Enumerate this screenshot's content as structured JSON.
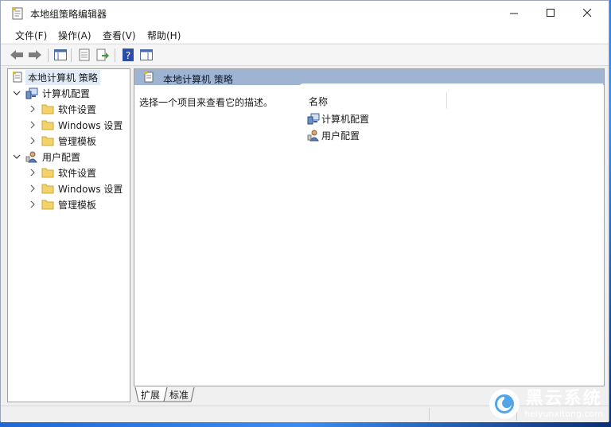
{
  "window": {
    "title": "本地组策略编辑器"
  },
  "menu": [
    {
      "label": "文件(F)"
    },
    {
      "label": "操作(A)"
    },
    {
      "label": "查看(V)"
    },
    {
      "label": "帮助(H)"
    }
  ],
  "tree": {
    "root": "本地计算机 策略",
    "computer": {
      "label": "计算机配置",
      "children": [
        {
          "label": "软件设置"
        },
        {
          "label": "Windows 设置"
        },
        {
          "label": "管理模板"
        }
      ]
    },
    "user": {
      "label": "用户配置",
      "children": [
        {
          "label": "软件设置"
        },
        {
          "label": "Windows 设置"
        },
        {
          "label": "管理模板"
        }
      ]
    }
  },
  "right_pane": {
    "header": "本地计算机 策略",
    "description": "选择一个项目来查看它的描述。",
    "column_name": "名称",
    "items": [
      {
        "label": "计算机配置"
      },
      {
        "label": "用户配置"
      }
    ]
  },
  "tabs": [
    {
      "label": "扩展"
    },
    {
      "label": "标准"
    }
  ],
  "watermark": {
    "title": "黑云系统",
    "subtitle": "heiyunxitong.com"
  },
  "colors": {
    "header_bar": "#9eb4d2",
    "folder": "#f2d36b",
    "selection": "#e1ecf8",
    "help_icon": "#2b4fa8"
  }
}
